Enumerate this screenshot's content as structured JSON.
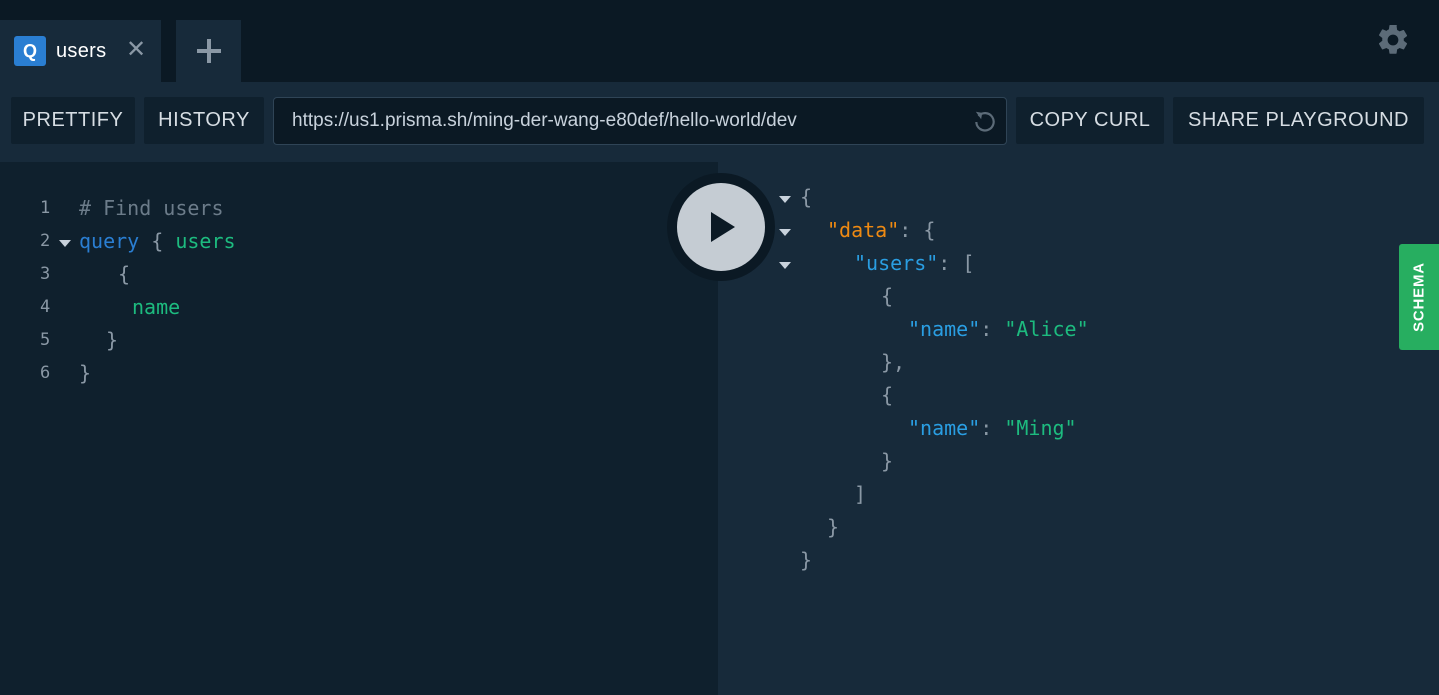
{
  "tabs": [
    {
      "badge": "Q",
      "label": "users",
      "close": "✕"
    }
  ],
  "new_tab": "+",
  "toolbar": {
    "prettify": "PRETTIFY",
    "history": "HISTORY",
    "endpoint_url": "https://us1.prisma.sh/ming-der-wang-e80def/hello-world/dev",
    "copy_curl": "COPY CURL",
    "share": "SHARE PLAYGROUND"
  },
  "query_editor": {
    "lines": [
      {
        "num": "1",
        "text": "# Find users"
      },
      {
        "num": "2",
        "kw": "query",
        "open": " { ",
        "field": "users"
      },
      {
        "num": "3",
        "text": "{"
      },
      {
        "num": "4",
        "field": "name"
      },
      {
        "num": "5",
        "text": "}"
      },
      {
        "num": "6",
        "text": "}"
      }
    ]
  },
  "result": {
    "open": "{",
    "data_key": "\"data\"",
    "users_key": "\"users\"",
    "name_key": "\"name\"",
    "values": [
      "\"Alice\"",
      "\"Ming\""
    ]
  },
  "schema_tab": "SCHEMA",
  "icons": {
    "settings": "gear-icon",
    "run": "play-icon",
    "reload": "reload-icon",
    "add": "plus-icon",
    "close": "close-icon"
  },
  "colors": {
    "accent": "#2a7ed2",
    "schema": "#27ae60",
    "string": "#1dbb7f",
    "object_key": "#ef8a12"
  }
}
